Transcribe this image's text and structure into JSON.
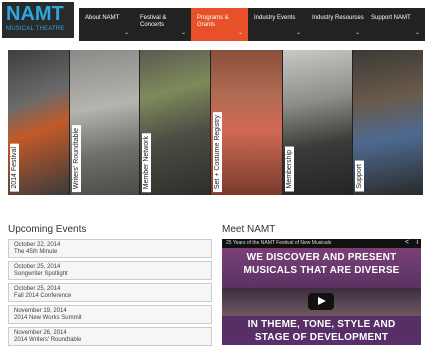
{
  "logo": {
    "text": "NAMT",
    "subtitle": "MUSICAL THEATRE",
    "color": "#29a9e0"
  },
  "nav": [
    {
      "label": "About NAMT"
    },
    {
      "label": "Festival & Concerts"
    },
    {
      "label": "Programs & Grants",
      "active": true
    },
    {
      "label": "Industry Events"
    },
    {
      "label": "Industry Resources"
    },
    {
      "label": "Support NAMT"
    }
  ],
  "nav_chevron": "⌄",
  "accent": "#e8502a",
  "hero_panels": [
    {
      "label": "2014 Festival"
    },
    {
      "label": "Writers' Roundtable"
    },
    {
      "label": "Member Network"
    },
    {
      "label": "Set + Costume Registry"
    },
    {
      "label": "Membership"
    },
    {
      "label": "Support"
    }
  ],
  "events": {
    "title": "Upcoming Events",
    "items": [
      {
        "date": "October 22, 2014",
        "name": "The 45th Minute"
      },
      {
        "date": "October 25, 2014",
        "name": "Songwriter Spotlight"
      },
      {
        "date": "October 25, 2014",
        "name": "Fall 2014 Conference"
      },
      {
        "date": "November 19, 2014",
        "name": "2014 New Works Summit"
      },
      {
        "date": "November 26, 2014",
        "name": "2014 Writers' Roundtable"
      }
    ]
  },
  "meet": {
    "title": "Meet NAMT",
    "video_title": "25 Years of the NAMT Festival of New Musicals",
    "share_icon": "<",
    "info_icon": "i",
    "lines": [
      "WE DISCOVER AND PRESENT",
      "MUSICALS THAT ARE DIVERSE",
      "IN THEME, TONE, STYLE AND",
      "STAGE OF DEVELOPMENT"
    ]
  }
}
